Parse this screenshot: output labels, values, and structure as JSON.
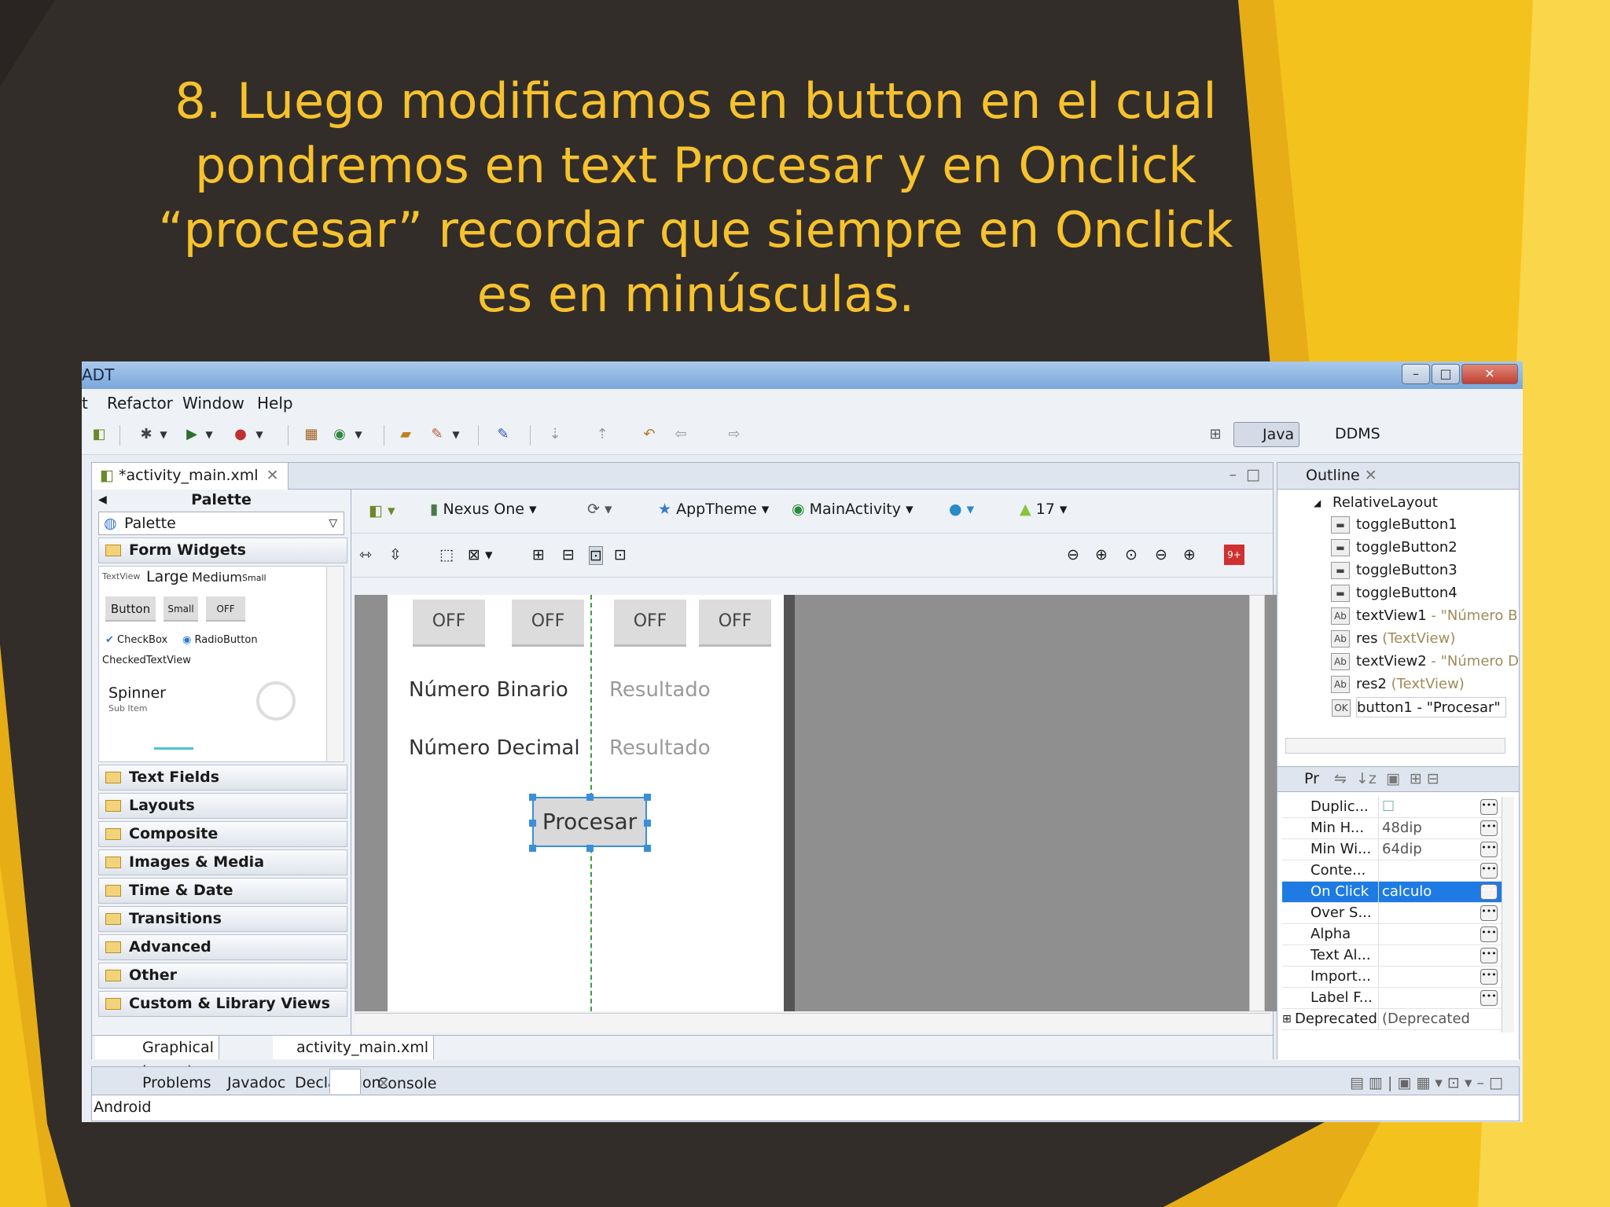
{
  "slide": {
    "title_lines": [
      "8. Luego modificamos en button en el cual",
      "pondremos en text Procesar y en Onclick",
      "“procesar” recordar que siempre en Onclick",
      "es en minúsculas."
    ]
  },
  "window": {
    "title": "ADT"
  },
  "menu": {
    "items": [
      "t",
      "Refactor",
      "Window",
      "Help"
    ]
  },
  "toolbar": {
    "perspectives": [
      "Java",
      "DDMS"
    ]
  },
  "editor": {
    "tab": "*activity_main.xml",
    "palette_header": "Palette",
    "palette_select": "Palette",
    "form_widgets": "Form Widgets",
    "widgets": {
      "textview_label": "TextView",
      "large": "Large",
      "medium": "Medium",
      "small": "Small",
      "button": "Button",
      "small_btn": "Small",
      "off": "OFF",
      "checkbox": "CheckBox",
      "radio": "RadioButton",
      "checked": "CheckedTextView",
      "spinner": "Spinner",
      "sub_item": "Sub Item"
    },
    "categories": [
      "Text Fields",
      "Layouts",
      "Composite",
      "Images & Media",
      "Time & Date",
      "Transitions",
      "Advanced",
      "Other",
      "Custom & Library Views"
    ],
    "config": {
      "device": "Nexus One",
      "theme": "AppTheme",
      "activity": "MainActivity",
      "api": "17"
    },
    "canvas": {
      "toggles": [
        "OFF",
        "OFF",
        "OFF",
        "OFF"
      ],
      "label1": "Número Binario",
      "res1": "Resultado",
      "label2": "Número Decimal",
      "res2": "Resultado",
      "button": "Procesar"
    },
    "bottom_tabs": [
      "Graphical Layout",
      "activity_main.xml"
    ]
  },
  "outline": {
    "tab": "Outline",
    "root": "RelativeLayout",
    "items": [
      {
        "name": "toggleButton1",
        "detail": ""
      },
      {
        "name": "toggleButton2",
        "detail": ""
      },
      {
        "name": "toggleButton3",
        "detail": ""
      },
      {
        "name": "toggleButton4",
        "detail": ""
      },
      {
        "name": "textView1",
        "detail": " - \"Número B"
      },
      {
        "name": "res",
        "detail": " (TextView)"
      },
      {
        "name": "textView2",
        "detail": " - \"Número D"
      },
      {
        "name": "res2",
        "detail": " (TextView)"
      },
      {
        "name": "button1",
        "detail": " - \"Procesar\""
      }
    ]
  },
  "properties": {
    "tab": "Pr",
    "rows": [
      {
        "name": "Duplic...",
        "value": ""
      },
      {
        "name": "Min H...",
        "value": "48dip"
      },
      {
        "name": "Min Wi...",
        "value": "64dip"
      },
      {
        "name": "Conte...",
        "value": ""
      },
      {
        "name": "On Click",
        "value": "calculo"
      },
      {
        "name": "Over S...",
        "value": ""
      },
      {
        "name": "Alpha",
        "value": ""
      },
      {
        "name": "Text Al...",
        "value": ""
      },
      {
        "name": "Import...",
        "value": ""
      },
      {
        "name": "Label F...",
        "value": ""
      },
      {
        "name": "Deprecated",
        "value": "(Deprecated ..."
      }
    ]
  },
  "console": {
    "tabs": [
      "Problems",
      "Javadoc",
      "Declaration",
      "Console"
    ],
    "text": "Android"
  },
  "colors": {
    "title": "#f6c22d",
    "background": "#332d29",
    "accent": "#e8b820",
    "selection": "#1e7be3"
  }
}
